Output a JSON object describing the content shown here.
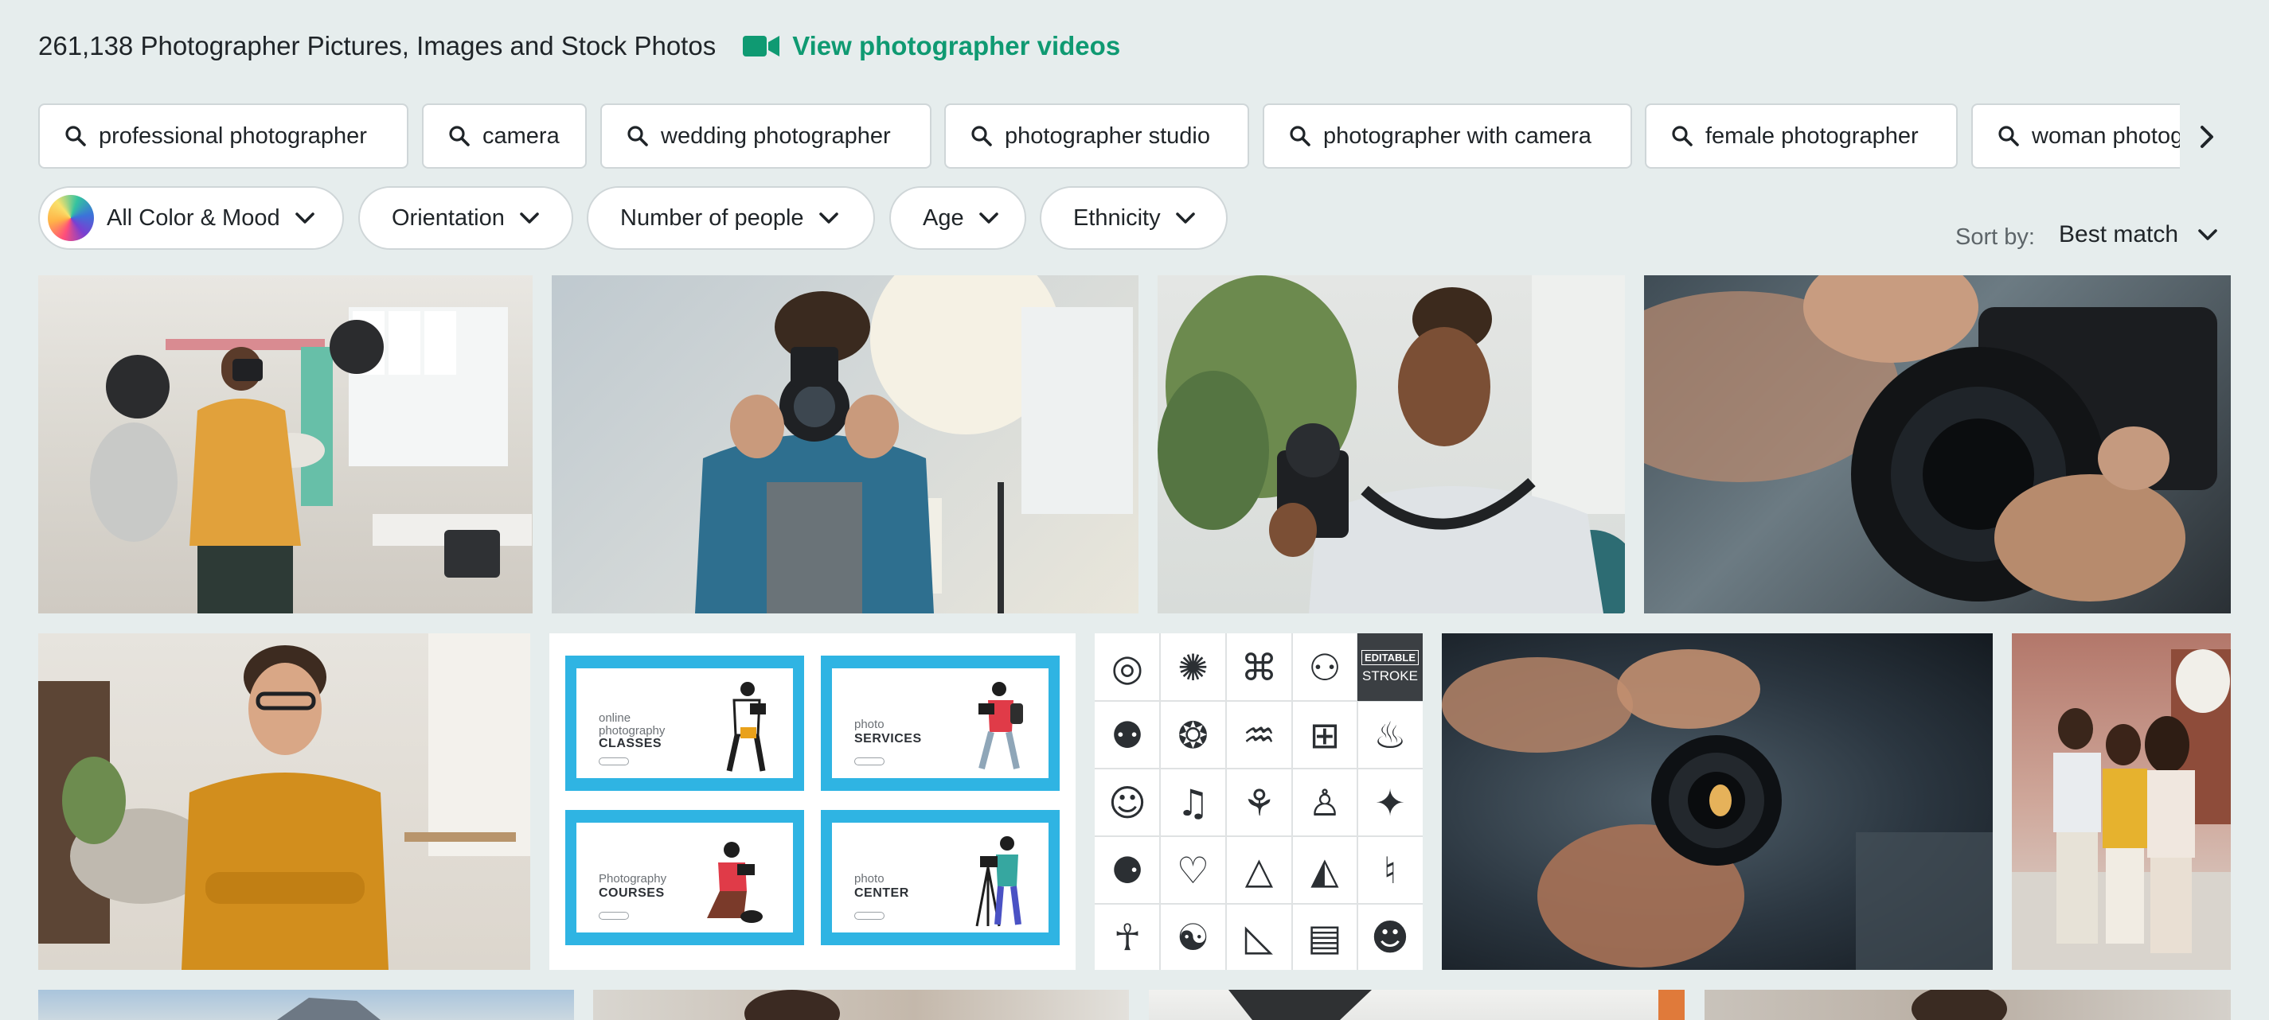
{
  "header": {
    "title": "261,138 Photographer Pictures, Images and Stock Photos",
    "video_link": "View photographer videos"
  },
  "related_searches": [
    "professional photographer",
    "camera",
    "wedding photographer",
    "photographer studio",
    "photographer with camera",
    "female photographer",
    "woman photographer"
  ],
  "filters": {
    "color_mood": "All Color & Mood",
    "orientation": "Orientation",
    "people": "Number of people",
    "age": "Age",
    "ethnicity": "Ethnicity"
  },
  "sort": {
    "label": "Sort by:",
    "value": "Best match"
  },
  "illustration": {
    "panels": [
      {
        "line1": "online",
        "line2": "photography",
        "big": "CLASSES"
      },
      {
        "line1": "photo",
        "big": "SERVICES"
      },
      {
        "line1": "Photography",
        "big": "COURSES"
      },
      {
        "line1": "photo",
        "big": "CENTER"
      }
    ]
  },
  "icon_set": {
    "badge_line1": "EDITABLE",
    "badge_line2": "STROKE"
  },
  "colors": {
    "background": "#e6eded",
    "accent": "#0f9a72",
    "chip_border": "#cfd6d8",
    "banner_blue": "#2fb4e3"
  }
}
